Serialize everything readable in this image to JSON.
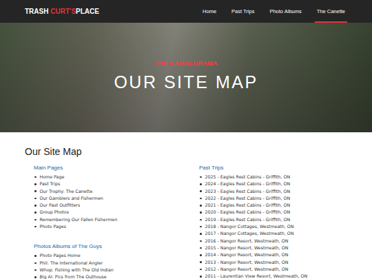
{
  "header": {
    "logo": [
      {
        "text": "TRASH ",
        "accent": false
      },
      {
        "text": "CURT'S",
        "accent": true
      },
      {
        "text": "PLACE",
        "accent": false
      }
    ],
    "nav": [
      {
        "label": "Home",
        "selected": false
      },
      {
        "label": "Past Trips",
        "selected": false
      },
      {
        "label": "Photo Albums",
        "selected": false
      },
      {
        "label": "The Canette",
        "selected": true
      }
    ]
  },
  "hero": {
    "kicker": "THE GAMBLORAMA",
    "title": "OUR SITE MAP"
  },
  "sitemap": {
    "title": "Our Site Map",
    "columns": [
      {
        "sections": [
          {
            "heading": "Main Pages",
            "items": [
              "Home Page",
              "Past Trips",
              "Our Trophy: The Canette",
              "Our Gamblers and Fishermen",
              "Our Past Outfitters",
              "Group Photos",
              "Remembering Our Fallen Fishermen",
              "Photo Pages"
            ]
          },
          {
            "heading": "Photos Albums of The Guys",
            "items": [
              "Photo Pages Home",
              "Phil: The International Angler",
              "Whop: Fishing with The Old Indian",
              "Big Al: Pics from The Outhouse"
            ]
          }
        ]
      },
      {
        "sections": [
          {
            "heading": "Past Trips",
            "items": [
              "2025 - Eagles Rest Cabins - Griffith, ON",
              "2024 - Eagles Rest Cabins - Griffith, ON",
              "2023 - Eagles Rest Cabins - Griffith, ON",
              "2022 - Eagles Rest Cabins - Griffith, ON",
              "2021 - Eagles Rest Cabins - Griffith, ON",
              "2020 - Eagles Rest Cabins - Griffith, ON",
              "2019 - Eagles Rest Cabins - Griffith, ON",
              "2018 - Nangor Cottages, Westmeath, ON",
              "2017 - Nangor Cottages, Westmeath, ON",
              "2016 - Nangor Resort, Westmeath, ON",
              "2015 - Nangor Resort, Westmeath, ON",
              "2014 - Nangor Resort, Westmeath, ON",
              "2013 - Nangor Resort, Westmeath, ON",
              "2012 - Nangor Resort, Westmeath, ON",
              "2011 - Laurentian View Resort, Westmeath, ON"
            ]
          }
        ]
      }
    ]
  }
}
